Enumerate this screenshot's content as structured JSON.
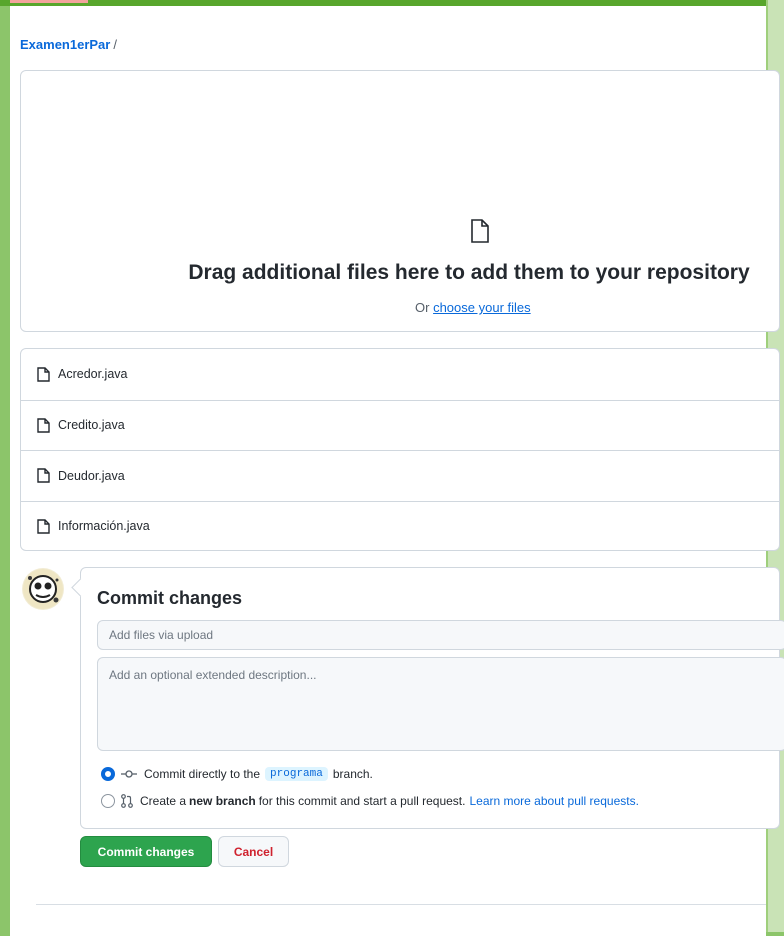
{
  "breadcrumb": {
    "repo": "Examen1erPar",
    "separator": "/"
  },
  "dropzone": {
    "icon": "file-icon",
    "title": "Drag additional files here to add them to your repository",
    "prefix": "Or",
    "link": "choose your files"
  },
  "files": [
    {
      "name": "Acredor.java",
      "icon": "file-icon"
    },
    {
      "name": "Credito.java",
      "icon": "file-icon"
    },
    {
      "name": "Deudor.java",
      "icon": "file-icon"
    },
    {
      "name": "Información.java",
      "icon": "file-icon"
    }
  ],
  "commit": {
    "title": "Commit changes",
    "summary_placeholder": "Add files via upload",
    "description_placeholder": "Add an optional extended description...",
    "option_direct": {
      "selected": true,
      "before": "Commit directly to the",
      "branch": "programa",
      "after": "branch."
    },
    "option_new": {
      "selected": false,
      "before": "Create a",
      "bold": "new branch",
      "after": "for this commit and start a pull request.",
      "link": "Learn more about pull requests."
    }
  },
  "buttons": {
    "commit": "Commit changes",
    "cancel": "Cancel"
  },
  "colors": {
    "primary": "#2da44e",
    "link": "#0969da",
    "danger": "#cf222e",
    "frame": "#8cc56a"
  }
}
